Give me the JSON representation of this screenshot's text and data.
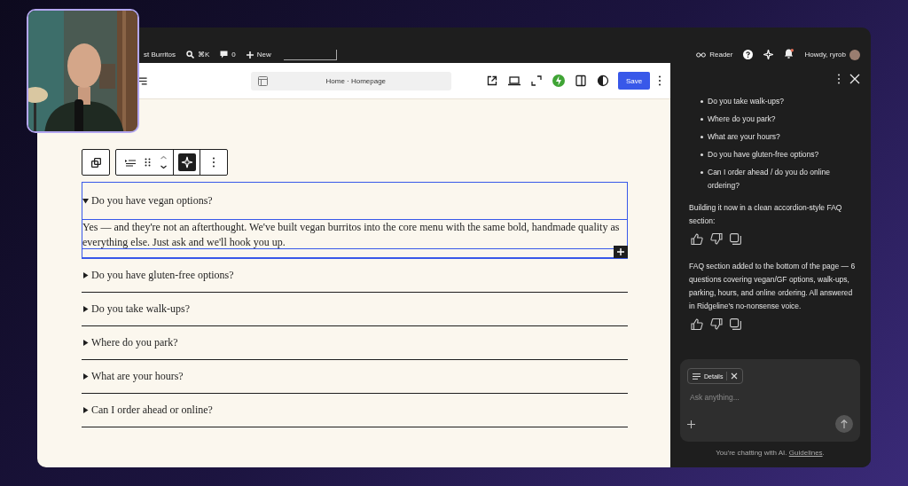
{
  "admin_bar": {
    "site": "st Burritos",
    "shortcut": "⌘K",
    "comments": "0",
    "new": "New",
    "reader": "Reader",
    "howdy": "Howdy, ryrob",
    "unread_notifications": true
  },
  "editor_header": {
    "breadcrumb": "Home · Homepage",
    "save": "Save"
  },
  "faq": [
    {
      "question": "Do you have vegan options?",
      "expanded": true,
      "selected": true,
      "answer": "Yes — and they're not an afterthought. We've built vegan burritos into the core menu with the same bold, handmade quality as everything else. Just ask and we'll hook you up."
    },
    {
      "question": "Do you have gluten-free options?",
      "expanded": false,
      "selected": false
    },
    {
      "question": "Do you take walk-ups?",
      "expanded": false,
      "selected": false
    },
    {
      "question": "Where do you park?",
      "expanded": false,
      "selected": false
    },
    {
      "question": "What are your hours?",
      "expanded": false,
      "selected": false
    },
    {
      "question": "Can I order ahead or online?",
      "expanded": false,
      "selected": false
    }
  ],
  "chat": {
    "bullets": [
      "Do you take walk-ups?",
      "Where do you park?",
      "What are your hours?",
      "Do you have gluten-free options?",
      "Can I order ahead / do you do online ordering?"
    ],
    "messages": [
      "Building it now in a clean accordion-style FAQ section:",
      "FAQ section added to the bottom of the page — 6 questions covering vegan/GF options, walk-ups, parking, hours, and online ordering. All answered in Ridgeline's no-nonsense voice."
    ],
    "composer": {
      "chip": "Details",
      "placeholder": "Ask anything..."
    },
    "footer": {
      "text": "You're chatting with AI.",
      "link": "Guidelines",
      "after": "."
    }
  }
}
